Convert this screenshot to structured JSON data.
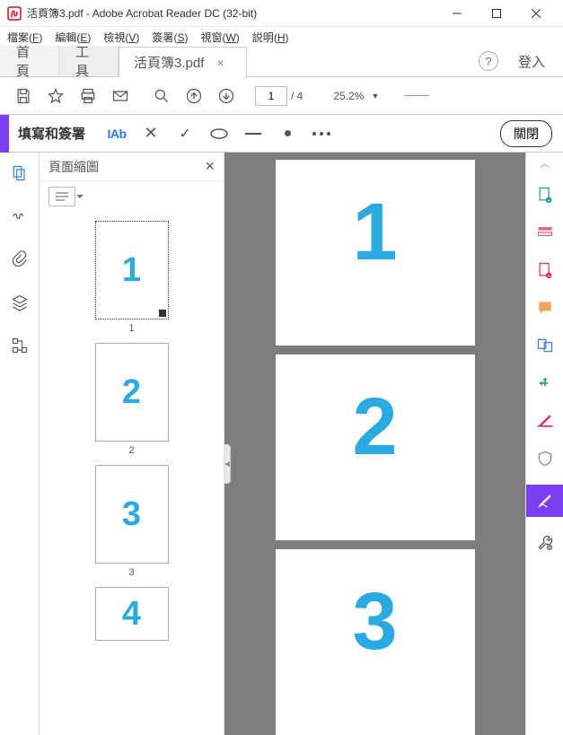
{
  "titlebar": {
    "title": "活頁簿3.pdf - Adobe Acrobat Reader DC (32-bit)"
  },
  "menubar": {
    "items": [
      {
        "label": "檔案",
        "accel": "F"
      },
      {
        "label": "編輯",
        "accel": "E"
      },
      {
        "label": "檢視",
        "accel": "V"
      },
      {
        "label": "簽署",
        "accel": "S"
      },
      {
        "label": "視窗",
        "accel": "W"
      },
      {
        "label": "説明",
        "accel": "H"
      }
    ]
  },
  "tabs": {
    "home": "首頁",
    "tools": "工具",
    "doc": "活頁簿3.pdf",
    "login": "登入"
  },
  "toolbar": {
    "page_current": "1",
    "page_total": "/ 4",
    "zoom": "25.2%"
  },
  "signbar": {
    "title": "填寫和簽署",
    "iab": "IAb",
    "close": "關閉"
  },
  "thumbpanel": {
    "title": "頁面縮圖",
    "pages": [
      {
        "num": "1",
        "label": "1",
        "selected": true
      },
      {
        "num": "2",
        "label": "2",
        "selected": false
      },
      {
        "num": "3",
        "label": "3",
        "selected": false
      },
      {
        "num": "4",
        "label": "4",
        "selected": false
      }
    ]
  },
  "docview": {
    "pages": [
      {
        "num": "1"
      },
      {
        "num": "2"
      },
      {
        "num": "3"
      }
    ]
  }
}
